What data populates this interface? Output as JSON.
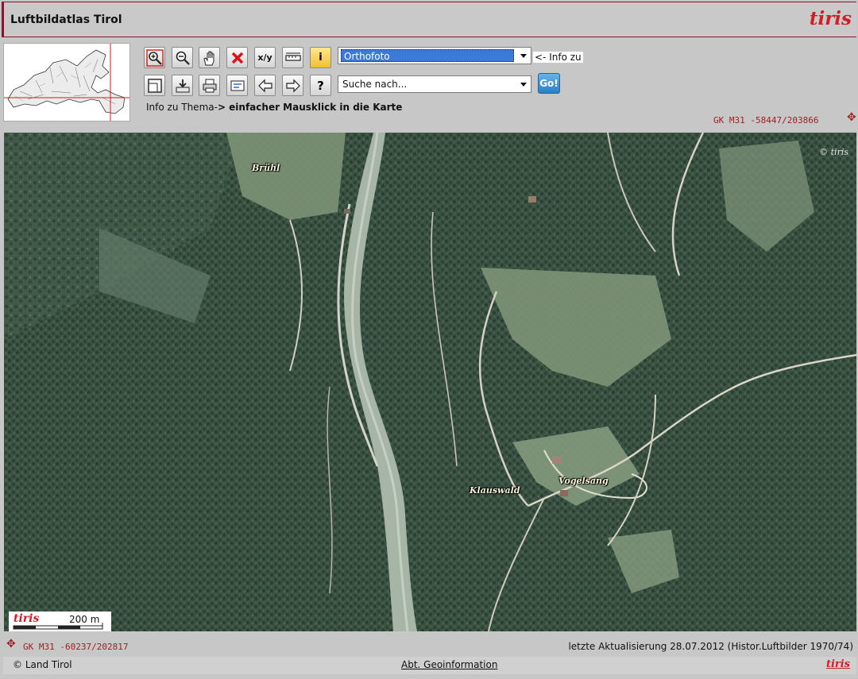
{
  "app": {
    "title": "Luftbildatlas Tirol",
    "brand": "tiris"
  },
  "toolbar": {
    "row1": [
      {
        "name": "zoom-in",
        "icon": "zoom-in-icon"
      },
      {
        "name": "zoom-out",
        "icon": "zoom-out-icon"
      },
      {
        "name": "pan",
        "icon": "hand-icon"
      },
      {
        "name": "clear",
        "icon": "red-x-icon"
      },
      {
        "name": "coordinates",
        "icon": "xy-icon",
        "text": "x/y"
      },
      {
        "name": "measure",
        "icon": "ruler-icon"
      },
      {
        "name": "info",
        "icon": "info-icon",
        "text": "i"
      }
    ],
    "row2": [
      {
        "name": "full-extent",
        "icon": "frame-icon"
      },
      {
        "name": "download",
        "icon": "download-icon"
      },
      {
        "name": "print",
        "icon": "printer-icon"
      },
      {
        "name": "legend",
        "icon": "legend-icon"
      },
      {
        "name": "back",
        "icon": "arrow-left-icon"
      },
      {
        "name": "forward",
        "icon": "arrow-right-icon"
      },
      {
        "name": "help",
        "icon": "question-icon",
        "text": "?"
      }
    ]
  },
  "theme_select": {
    "value": "Orthofoto",
    "hint": "<- Info zu"
  },
  "search": {
    "placeholder": "Suche nach...",
    "go_label": "Go!"
  },
  "info_instruction": {
    "prefix": "Info zu Thema-",
    "bold": "> einfacher Mausklick in die Karte"
  },
  "coords": {
    "top": "GK M31 -58447/203866",
    "bottom": "GK M31 -60237/202817"
  },
  "map": {
    "copyright": "© tiris",
    "places": [
      {
        "id": "bruehl",
        "name": "Brühl"
      },
      {
        "id": "klauswald",
        "name": "Klauswald"
      },
      {
        "id": "vogelsang",
        "name": "Vogelsang"
      }
    ],
    "scale": {
      "logo": "tiris",
      "label": "200 m"
    }
  },
  "footer": {
    "update": "letzte Aktualisierung 28.07.2012 (Histor.Luftbilder 1970/74)",
    "copyright": "© Land Tirol",
    "dept_link": "Abt. Geoinformation",
    "brand": "tiris"
  },
  "colors": {
    "brand_red": "#cc1f28",
    "title_border": "#8a1430",
    "coord_red": "#a02020",
    "select_highlight": "#3b7ad6"
  }
}
